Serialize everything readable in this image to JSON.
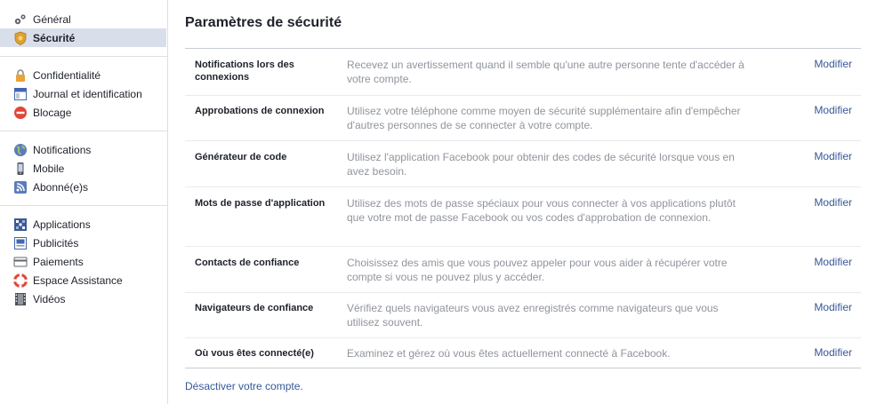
{
  "sidebar": {
    "groups": [
      [
        {
          "label": "Général",
          "icon": "gears-icon"
        },
        {
          "label": "Sécurité",
          "icon": "security-badge-icon",
          "active": true
        }
      ],
      [
        {
          "label": "Confidentialité",
          "icon": "lock-icon"
        },
        {
          "label": "Journal et identification",
          "icon": "timeline-icon"
        },
        {
          "label": "Blocage",
          "icon": "block-icon"
        }
      ],
      [
        {
          "label": "Notifications",
          "icon": "globe-icon"
        },
        {
          "label": "Mobile",
          "icon": "mobile-icon"
        },
        {
          "label": "Abonné(e)s",
          "icon": "rss-icon"
        }
      ],
      [
        {
          "label": "Applications",
          "icon": "apps-icon"
        },
        {
          "label": "Publicités",
          "icon": "ads-icon"
        },
        {
          "label": "Paiements",
          "icon": "card-icon"
        },
        {
          "label": "Espace Assistance",
          "icon": "lifebuoy-icon"
        },
        {
          "label": "Vidéos",
          "icon": "film-icon"
        }
      ]
    ]
  },
  "main": {
    "title": "Paramètres de sécurité",
    "rows": [
      {
        "name": "Notifications lors des connexions",
        "desc": "Recevez un avertissement quand il semble qu'une autre personne tente d'accéder à votre compte.",
        "action": "Modifier"
      },
      {
        "name": "Approbations de connexion",
        "desc": "Utilisez votre téléphone comme moyen de sécurité supplémentaire afin d'empêcher d'autres personnes de se connecter à votre compte.",
        "action": "Modifier"
      },
      {
        "name": "Générateur de code",
        "desc": "Utilisez l'application Facebook pour obtenir des codes de sécurité lorsque vous en avez besoin.",
        "action": "Modifier"
      },
      {
        "name": "Mots de passe d'application",
        "desc": "Utilisez des mots de passe spéciaux pour vous connecter à vos applications plutôt que votre mot de passe Facebook ou vos codes d'approbation de connexion.",
        "action": "Modifier"
      },
      {
        "name": "Contacts de confiance",
        "desc": "Choisissez des amis que vous pouvez appeler pour vous aider à récupérer votre compte si vous ne pouvez plus y accéder.",
        "action": "Modifier"
      },
      {
        "name": "Navigateurs de confiance",
        "desc": "Vérifiez quels navigateurs vous avez enregistrés comme navigateurs que vous utilisez souvent.",
        "action": "Modifier"
      },
      {
        "name": "Où vous êtes connecté(e)",
        "desc": "Examinez et gérez où vous êtes actuellement connecté à Facebook.",
        "action": "Modifier"
      }
    ],
    "deactivate": "Désactiver votre compte."
  },
  "colors": {
    "link": "#365899",
    "active_bg": "#d8dfea",
    "muted": "#90949c"
  }
}
